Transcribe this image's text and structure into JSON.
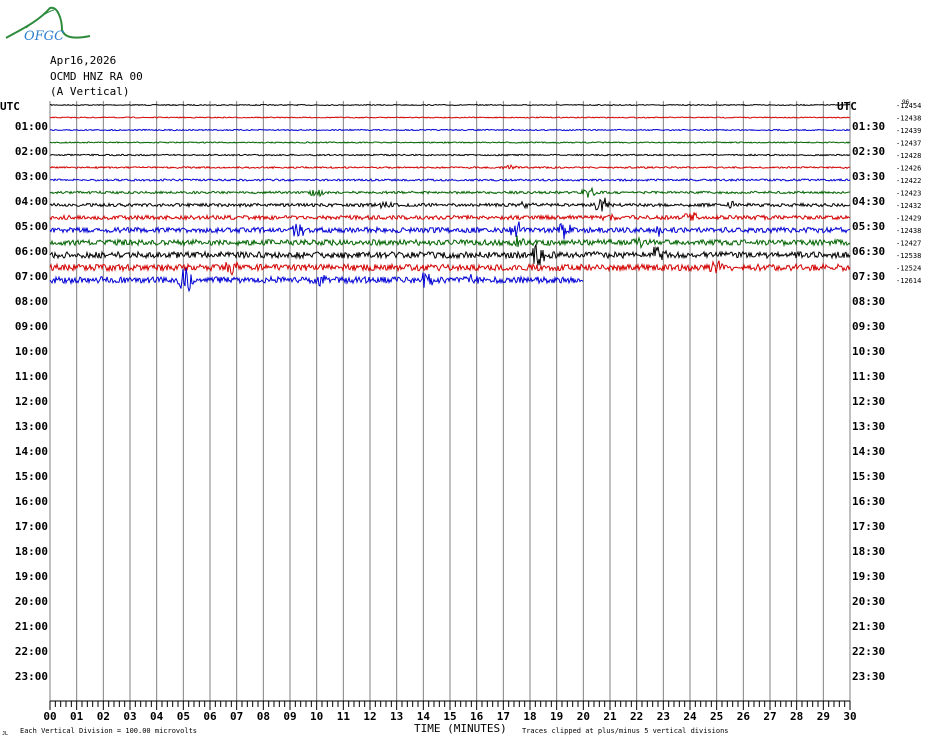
{
  "logo": {
    "text": "OFGC",
    "colors": {
      "text": "#2d7fd1",
      "swoosh": "#2e8b3c"
    }
  },
  "header": {
    "date": "Apr16,2026",
    "station": "OCMD HNZ RA 00",
    "component": "(A Vertical)"
  },
  "chart_data": {
    "type": "line",
    "title": "Apr16,2026 OCMD HNZ RA 00 (A Vertical)",
    "xlabel": "TIME (MINUTES)",
    "x_ticks": [
      "00",
      "01",
      "02",
      "03",
      "04",
      "05",
      "06",
      "07",
      "08",
      "09",
      "10",
      "11",
      "12",
      "13",
      "14",
      "15",
      "16",
      "17",
      "18",
      "19",
      "20",
      "21",
      "22",
      "23",
      "24",
      "25",
      "26",
      "27",
      "28",
      "29",
      "30"
    ],
    "left_label": "UTC",
    "right_label": "UTC",
    "left_hours": [
      "01:00",
      "02:00",
      "03:00",
      "04:00",
      "05:00",
      "06:00",
      "07:00",
      "08:00",
      "09:00",
      "10:00",
      "11:00",
      "12:00",
      "13:00",
      "14:00",
      "15:00",
      "16:00",
      "17:00",
      "18:00",
      "19:00",
      "20:00",
      "21:00",
      "22:00",
      "23:00"
    ],
    "right_hours": [
      "01:30",
      "02:30",
      "03:30",
      "04:30",
      "05:30",
      "06:30",
      "07:30",
      "08:30",
      "09:30",
      "10:30",
      "11:30",
      "12:30",
      "13:30",
      "14:30",
      "15:30",
      "16:30",
      "17:30",
      "18:30",
      "19:30",
      "20:30",
      "21:30",
      "22:30",
      "23:30"
    ],
    "trace_colors": [
      "#000000",
      "#d40000",
      "#0000d4",
      "#006400"
    ],
    "trace_offsets": [
      "-12454",
      "-12438",
      "-12439",
      "-12437",
      "-12428",
      "-12426",
      "-12422",
      "-12423",
      "-12432",
      "-12429",
      "-12438",
      "-12427",
      "-12538",
      "-12524",
      "-12614"
    ],
    "trace_offset_tag": "96",
    "last_trace_end_minute": 20,
    "noise_levels": [
      0.5,
      0.5,
      0.6,
      0.6,
      0.7,
      0.8,
      1.0,
      1.2,
      1.6,
      2.0,
      2.6,
      2.8,
      3.2,
      3.2,
      3.2
    ],
    "events": [
      {
        "trace": 5,
        "minute": 17.2,
        "amp": 3
      },
      {
        "trace": 7,
        "minute": 10.0,
        "amp": 6
      },
      {
        "trace": 7,
        "minute": 20.2,
        "amp": 7
      },
      {
        "trace": 8,
        "minute": 12.5,
        "amp": 4
      },
      {
        "trace": 8,
        "minute": 17.9,
        "amp": 5
      },
      {
        "trace": 8,
        "minute": 20.7,
        "amp": 9
      },
      {
        "trace": 8,
        "minute": 25.6,
        "amp": 4
      },
      {
        "trace": 9,
        "minute": 20.9,
        "amp": 4
      },
      {
        "trace": 9,
        "minute": 24.0,
        "amp": 6
      },
      {
        "trace": 10,
        "minute": 9.3,
        "amp": 7
      },
      {
        "trace": 10,
        "minute": 17.5,
        "amp": 9
      },
      {
        "trace": 10,
        "minute": 19.3,
        "amp": 8
      },
      {
        "trace": 10,
        "minute": 22.9,
        "amp": 6
      },
      {
        "trace": 11,
        "minute": 17.5,
        "amp": 6
      },
      {
        "trace": 11,
        "minute": 22.0,
        "amp": 5
      },
      {
        "trace": 12,
        "minute": 18.3,
        "amp": 12
      },
      {
        "trace": 12,
        "minute": 22.8,
        "amp": 11
      },
      {
        "trace": 13,
        "minute": 6.8,
        "amp": 7
      },
      {
        "trace": 13,
        "minute": 25.0,
        "amp": 6
      },
      {
        "trace": 14,
        "minute": 5.1,
        "amp": 18
      },
      {
        "trace": 14,
        "minute": 10.1,
        "amp": 8
      },
      {
        "trace": 14,
        "minute": 14.1,
        "amp": 10
      },
      {
        "trace": 14,
        "minute": 15.8,
        "amp": 7
      }
    ],
    "footer_left": "Each Vertical Division =  100.00 microvolts",
    "footer_right": "Traces clipped at plus/minus 5 vertical divisions",
    "footer_mark": "JL",
    "grid": true
  }
}
